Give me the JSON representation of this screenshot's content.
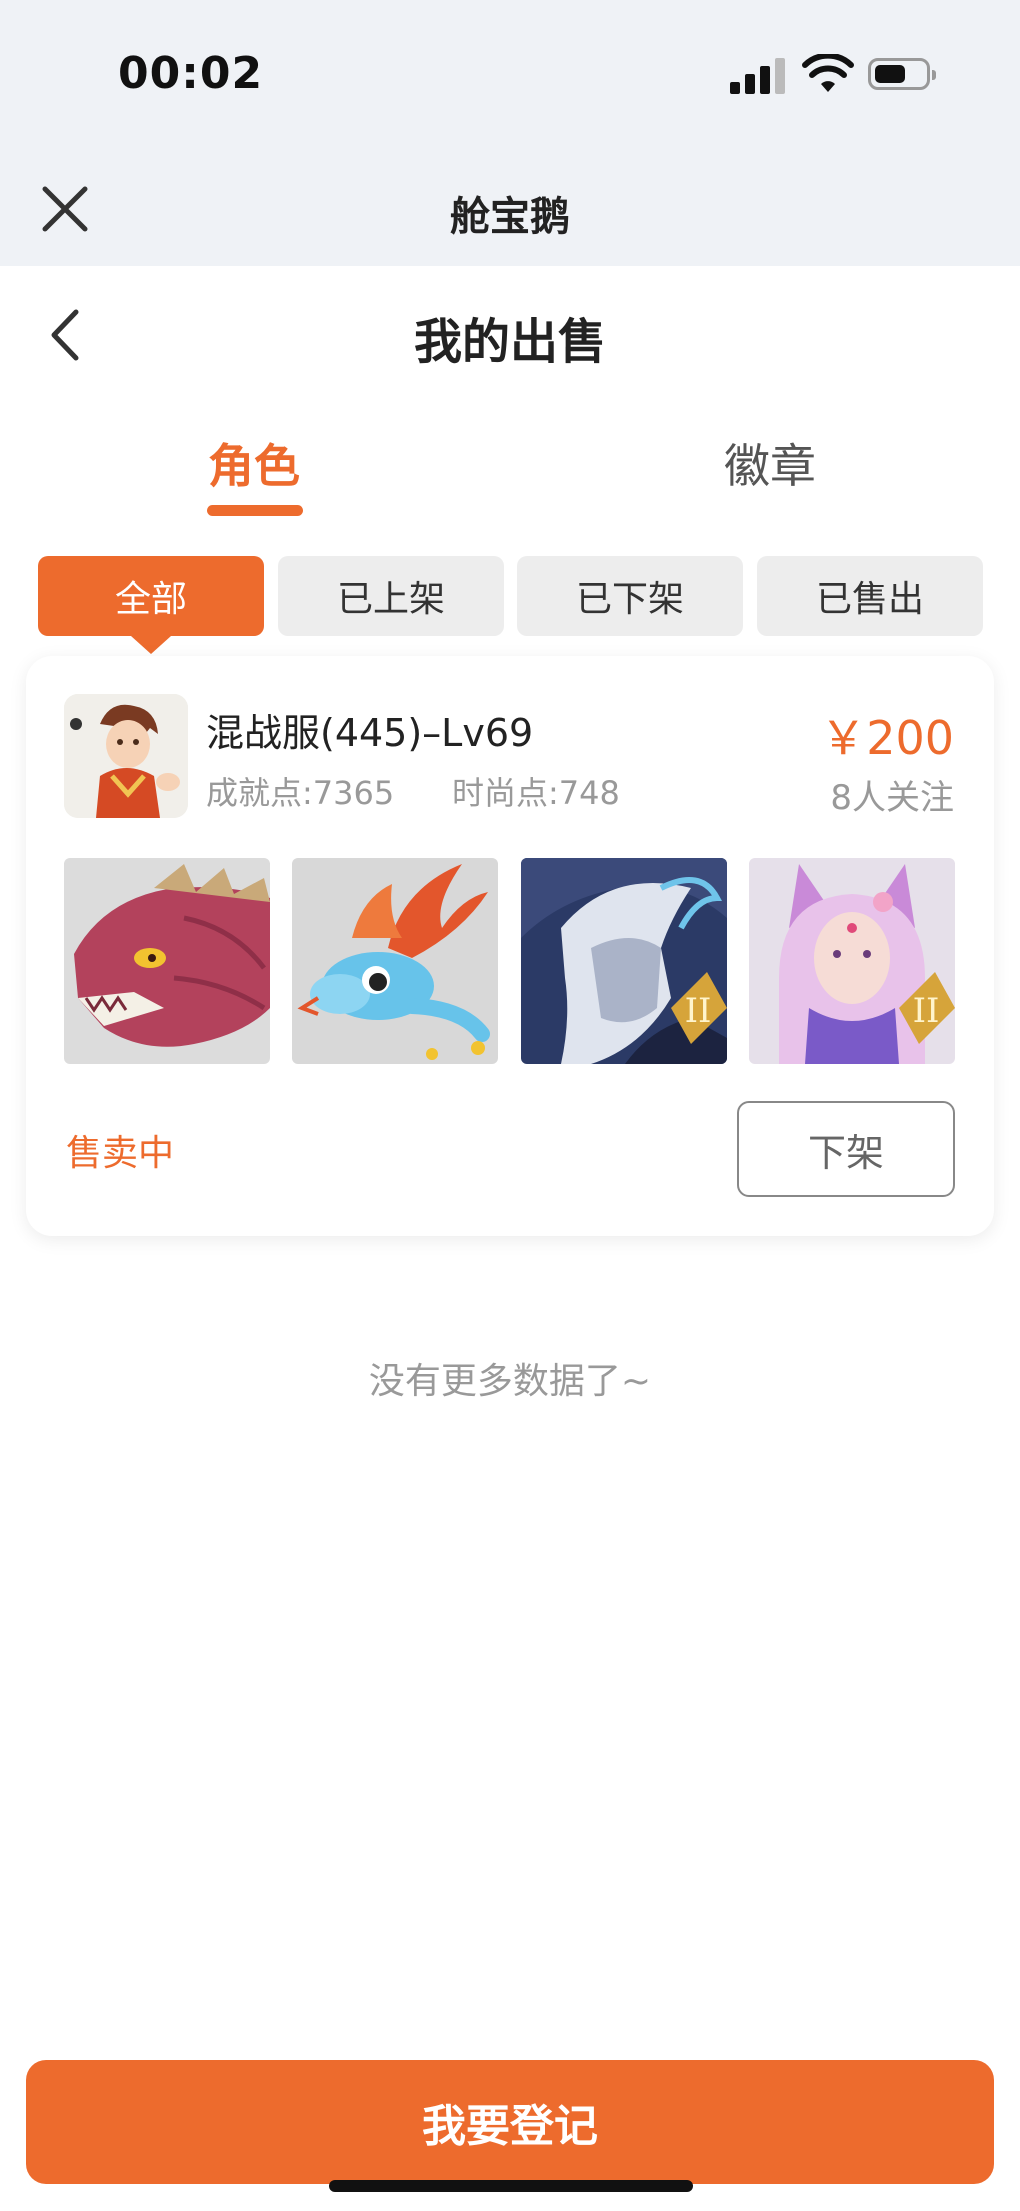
{
  "status_bar": {
    "time": "00:02"
  },
  "header": {
    "app_title": "舱宝鹅"
  },
  "page": {
    "title": "我的出售"
  },
  "tabs": [
    {
      "label": "角色",
      "active": true
    },
    {
      "label": "徽章",
      "active": false
    }
  ],
  "filters": [
    {
      "label": "全部",
      "active": true
    },
    {
      "label": "已上架",
      "active": false
    },
    {
      "label": "已下架",
      "active": false
    },
    {
      "label": "已售出",
      "active": false
    }
  ],
  "listing": {
    "server_name": "混战服(445)–Lv69",
    "achievement_points": "成就点:7365",
    "fashion_points": "时尚点:748",
    "price": "￥200",
    "followers": "8人关注",
    "items": [
      {
        "icon": "dragon-mount-icon"
      },
      {
        "icon": "blue-dragon-pet-icon"
      },
      {
        "icon": "armored-warrior-icon",
        "badge": "II"
      },
      {
        "icon": "fox-spirit-icon",
        "badge": "II"
      }
    ],
    "status": "售卖中",
    "delist_button": "下架"
  },
  "footer": {
    "no_more": "没有更多数据了~",
    "register_button": "我要登记"
  },
  "colors": {
    "accent": "#ed6b2d",
    "topbar": "#eff2f6"
  }
}
